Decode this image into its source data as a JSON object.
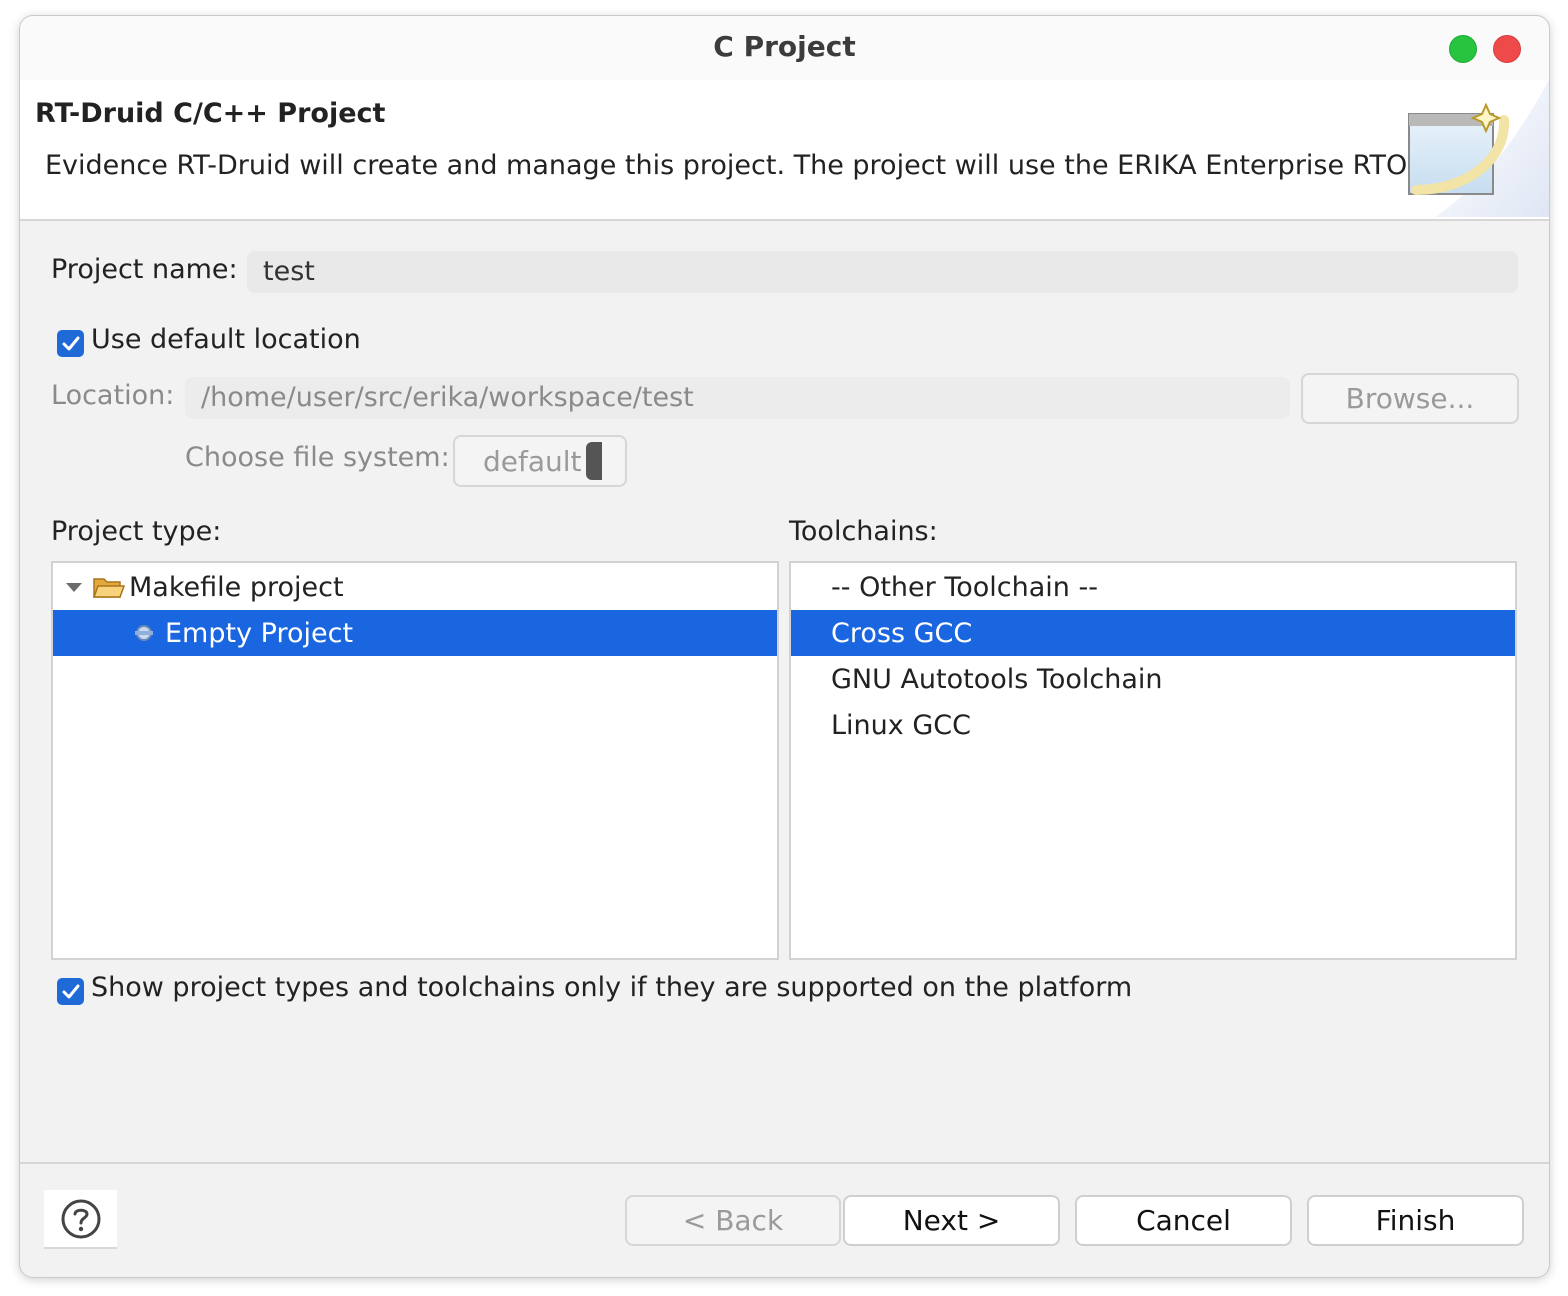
{
  "window": {
    "title": "C Project"
  },
  "header": {
    "title": "RT-Druid C/C++ Project",
    "description": "Evidence RT-Druid will create and manage this project. The project will use the ERIKA Enterprise RTOS."
  },
  "form": {
    "project_name_label": "Project name:",
    "project_name_value": "test",
    "use_default_location_label": "Use default location",
    "use_default_location_checked": true,
    "location_label": "Location:",
    "location_value": "/home/user/src/erika/workspace/test",
    "browse_label": "Browse...",
    "file_system_label": "Choose file system:",
    "file_system_value": "default"
  },
  "project_type": {
    "label": "Project type:",
    "items": [
      {
        "label": "Makefile project",
        "icon": "folder-open-icon",
        "expanded": true
      },
      {
        "label": "Empty Project",
        "icon": "project-gear-icon",
        "selected": true
      }
    ]
  },
  "toolchains": {
    "label": "Toolchains:",
    "items": [
      {
        "label": "-- Other Toolchain --"
      },
      {
        "label": "Cross GCC",
        "selected": true
      },
      {
        "label": "GNU Autotools Toolchain"
      },
      {
        "label": "Linux GCC"
      }
    ]
  },
  "filter": {
    "label": "Show project types and toolchains only if they are supported on the platform",
    "checked": true
  },
  "buttons": {
    "back": "< Back",
    "next": "Next >",
    "cancel": "Cancel",
    "finish": "Finish"
  },
  "colors": {
    "selection": "#1a66e0",
    "checkbox": "#1f6ad6",
    "maximize": "#27c43f",
    "close": "#ef4a4a"
  }
}
